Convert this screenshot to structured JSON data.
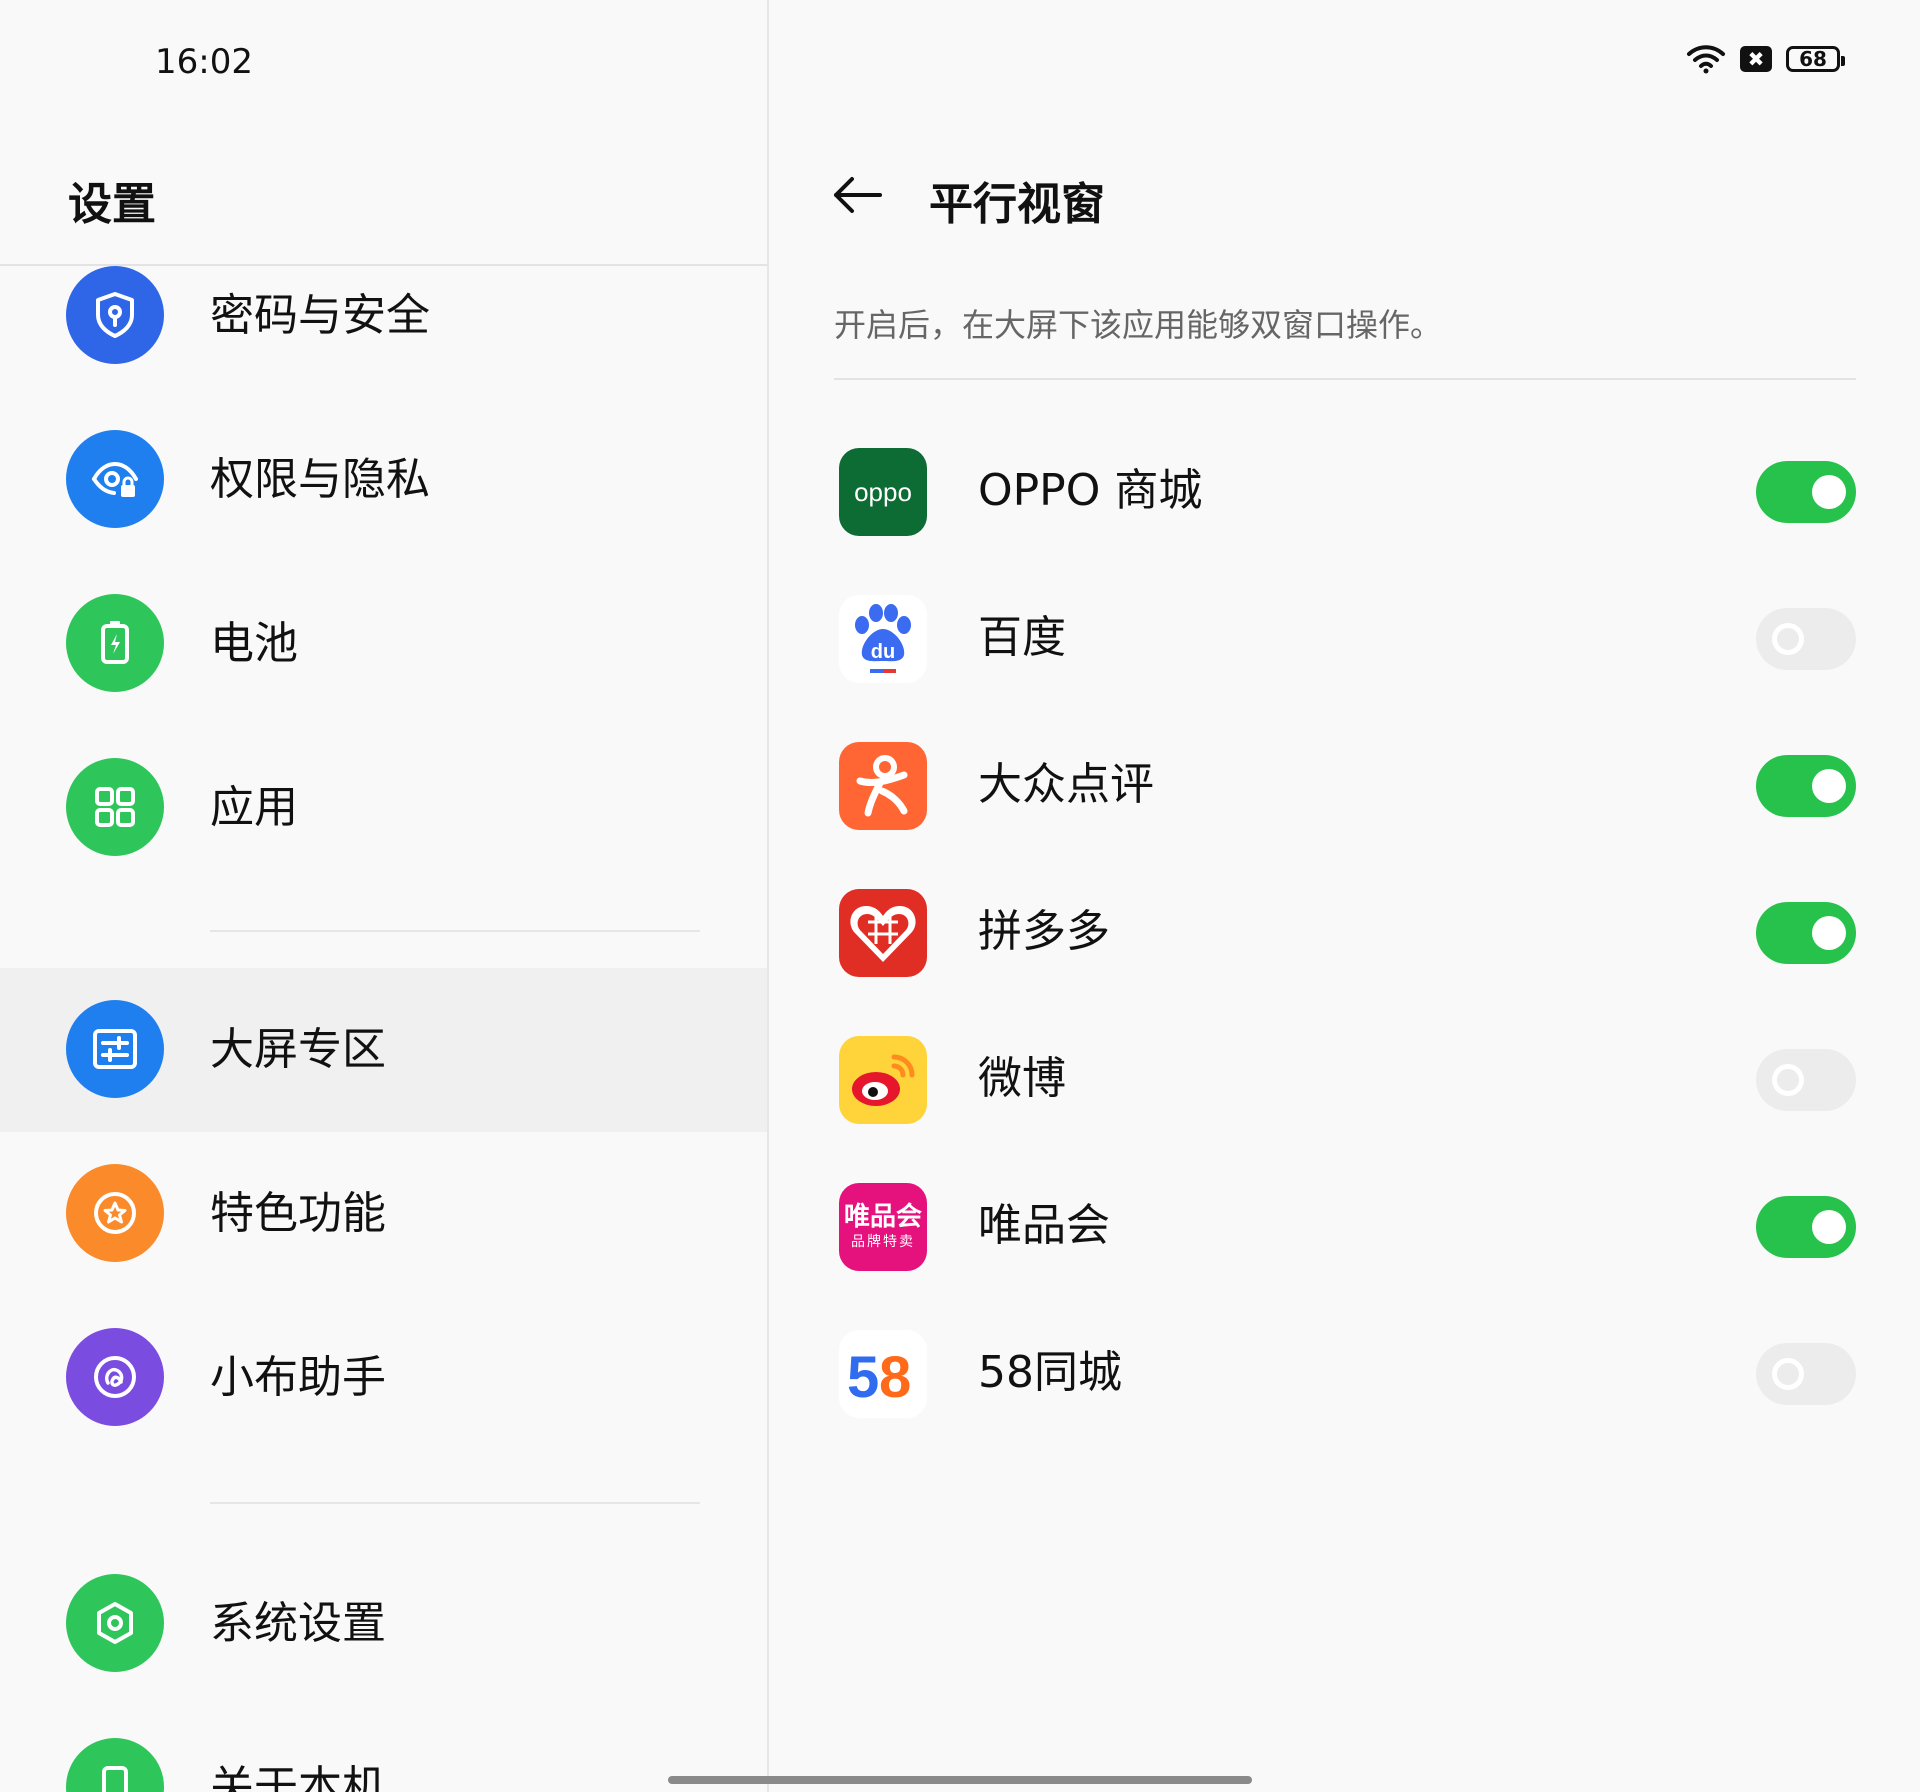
{
  "status_bar": {
    "time": "16:02",
    "battery_level": "68"
  },
  "left_panel": {
    "title": "设置",
    "items": [
      {
        "label": "密码与安全",
        "icon": "shield-icon",
        "color": "#2f66e8"
      },
      {
        "label": "权限与隐私",
        "icon": "privacy-eye-icon",
        "color": "#1f7fef"
      },
      {
        "label": "电池",
        "icon": "battery-icon",
        "color": "#2ec65a"
      },
      {
        "label": "应用",
        "icon": "apps-grid-icon",
        "color": "#2ec65a"
      },
      {
        "label": "大屏专区",
        "icon": "sliders-icon",
        "color": "#1f7fef",
        "selected": true
      },
      {
        "label": "特色功能",
        "icon": "star-icon",
        "color": "#fb8a2a"
      },
      {
        "label": "小布助手",
        "icon": "assistant-icon",
        "color": "#7a4ce0"
      },
      {
        "label": "系统设置",
        "icon": "hexagon-settings-icon",
        "color": "#2ec65a"
      },
      {
        "label": "关于本机",
        "icon": "phone-icon",
        "color": "#2ec65a"
      }
    ]
  },
  "right_panel": {
    "title": "平行视窗",
    "description": "开启后，在大屏下该应用能够双窗口操作。",
    "apps": [
      {
        "name": "OPPO 商城",
        "icon": "oppo-store-icon",
        "icon_text": "oppo",
        "enabled": true
      },
      {
        "name": "百度",
        "icon": "baidu-icon",
        "icon_text": "du",
        "enabled": false
      },
      {
        "name": "大众点评",
        "icon": "dianping-icon",
        "enabled": true
      },
      {
        "name": "拼多多",
        "icon": "pinduoduo-icon",
        "enabled": true
      },
      {
        "name": "微博",
        "icon": "weibo-icon",
        "enabled": false
      },
      {
        "name": "唯品会",
        "icon": "vipshop-icon",
        "icon_text": "唯品会",
        "icon_subtext": "品牌特卖",
        "enabled": true
      },
      {
        "name": "58同城",
        "icon": "58-icon",
        "icon_text": "58",
        "enabled": false
      }
    ]
  },
  "colors": {
    "toggle_on": "#27c24c",
    "toggle_off": "#ececec"
  }
}
